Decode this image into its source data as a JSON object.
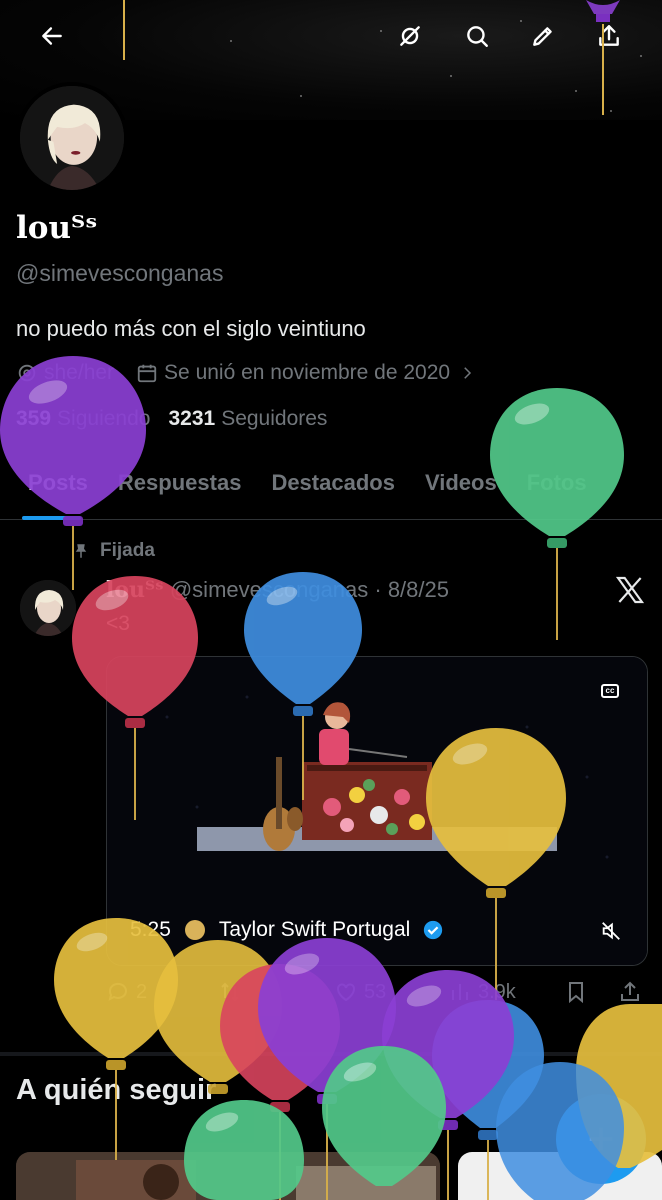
{
  "header": {
    "back_icon": "arrow-left-icon",
    "actions": [
      "grok-icon",
      "search-icon",
      "edit-icon",
      "share-icon"
    ]
  },
  "profile": {
    "name": "louᵀˢ",
    "handle": "@simevesconganas",
    "bio": "no puedo más con el siglo veintiuno",
    "pronouns": "she/her",
    "joined": "Se unió en noviembre de 2020",
    "following_count": "359",
    "following_label": "Siguiendo",
    "followers_count": "3231",
    "followers_label": "Seguidores"
  },
  "tabs": [
    {
      "label": "Posts",
      "active": true
    },
    {
      "label": "Respuestas",
      "active": false
    },
    {
      "label": "Destacados",
      "active": false
    },
    {
      "label": "Videos",
      "active": false
    },
    {
      "label": "Fotos",
      "active": false
    }
  ],
  "post": {
    "pinned_label": "Fijada",
    "author_name": "louᵀˢ",
    "author_meta": "@simevesconganas · 8/8/25",
    "text": "<3",
    "media": {
      "duration": "5:25",
      "source": "Taylor Swift Portugal",
      "cc_label": "cc"
    },
    "actions": {
      "replies": "2",
      "likes": "53",
      "views": "3.9k"
    }
  },
  "suggestions": {
    "title": "A quién seguir"
  },
  "colors": {
    "accent": "#1d9bf0",
    "background": "#000000",
    "muted": "#71767b",
    "text": "#e7e9ea"
  }
}
